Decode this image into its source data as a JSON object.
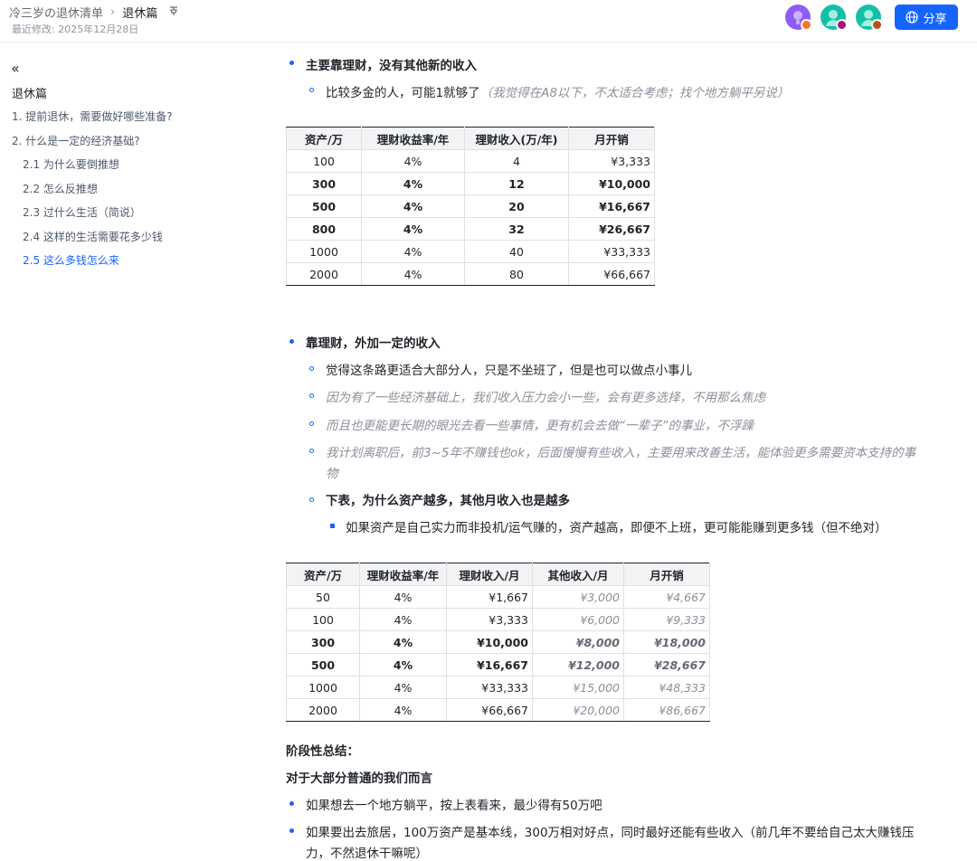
{
  "header": {
    "breadcrumb_parent": "冷三岁の退休清单",
    "breadcrumb_current": "退休篇",
    "pin_icon": "pin-icon",
    "last_modified": "最近修改: 2025年12月28日",
    "share_label": "分享",
    "avatars": [
      {
        "color": "#8e5cf5",
        "badge": "#f5752a"
      },
      {
        "color": "#14c0a5",
        "badge": "#a3167c"
      },
      {
        "color": "#14c0a5",
        "badge": "#b4541b"
      }
    ]
  },
  "sidebar": {
    "collapse_icon": "«",
    "title": "退休篇",
    "items": [
      {
        "label": "1. 提前退休，需要做好哪些准备?"
      },
      {
        "label": "2. 什么是一定的经济基础?"
      },
      {
        "label": "2.1 为什么要倒推想"
      },
      {
        "label": "2.2 怎么反推想"
      },
      {
        "label": "2.3 过什么生活（简说）"
      },
      {
        "label": "2.4 这样的生活需要花多少钱"
      },
      {
        "label": "2.5 这么多钱怎么来"
      }
    ]
  },
  "section1": {
    "heading": "主要靠理财，没有其他新的收入",
    "sub_text": "比较多金的人，可能1就够了",
    "sub_note": "（我觉得在A8以下，不太适合考虑；找个地方躺平另说）"
  },
  "table1": {
    "headers": [
      "资产/万",
      "理财收益率/年",
      "理财收入(万/年)",
      "月开销"
    ],
    "rows": [
      [
        "100",
        "4%",
        "4",
        "¥3,333"
      ],
      [
        "300",
        "4%",
        "12",
        "¥10,000"
      ],
      [
        "500",
        "4%",
        "20",
        "¥16,667"
      ],
      [
        "800",
        "4%",
        "32",
        "¥26,667"
      ],
      [
        "1000",
        "4%",
        "40",
        "¥33,333"
      ],
      [
        "2000",
        "4%",
        "80",
        "¥66,667"
      ]
    ]
  },
  "section2": {
    "heading": "靠理财，外加一定的收入",
    "items": [
      "觉得这条路更适合大部分人，只是不坐班了，但是也可以做点小事儿",
      "因为有了一些经济基础上，我们收入压力会小一些，会有更多选择，不用那么焦虑",
      "而且也更能更长期的眼光去看一些事情，更有机会去做“一辈子”的事业，不浮躁",
      "我计划离职后，前3~5年不赚钱也ok，后面慢慢有些收入，主要用来改善生活，能体验更多需要资本支持的事",
      "物"
    ],
    "bold_item": "下表，为什么资产越多，其他月收入也是越多",
    "sub_item": "如果资产是自己实力而非投机/运气赚的，资产越高，即便不上班，更可能能赚到更多钱（但不绝对）"
  },
  "table2": {
    "headers": [
      "资产/万",
      "理财收益率/年",
      "理财收入/月",
      "其他收入/月",
      "月开销"
    ],
    "rows": [
      [
        "50",
        "4%",
        "¥1,667",
        "¥3,000",
        "¥4,667"
      ],
      [
        "100",
        "4%",
        "¥3,333",
        "¥6,000",
        "¥9,333"
      ],
      [
        "300",
        "4%",
        "¥10,000",
        "¥8,000",
        "¥18,000"
      ],
      [
        "500",
        "4%",
        "¥16,667",
        "¥12,000",
        "¥28,667"
      ],
      [
        "1000",
        "4%",
        "¥33,333",
        "¥15,000",
        "¥48,333"
      ],
      [
        "2000",
        "4%",
        "¥66,667",
        "¥20,000",
        "¥86,667"
      ]
    ]
  },
  "summary": {
    "title": "阶段性总结：",
    "subtitle": "对于大部分普通的我们而言",
    "items": [
      "如果想去一个地方躺平，按上表看来，最少得有50万吧",
      "如果要出去旅居，100万资产是基本线，300万相对好点，同时最好还能有些收入（前几年不要给自己太大赚钱压",
      "力，不然退休干嘛呢）"
    ]
  }
}
